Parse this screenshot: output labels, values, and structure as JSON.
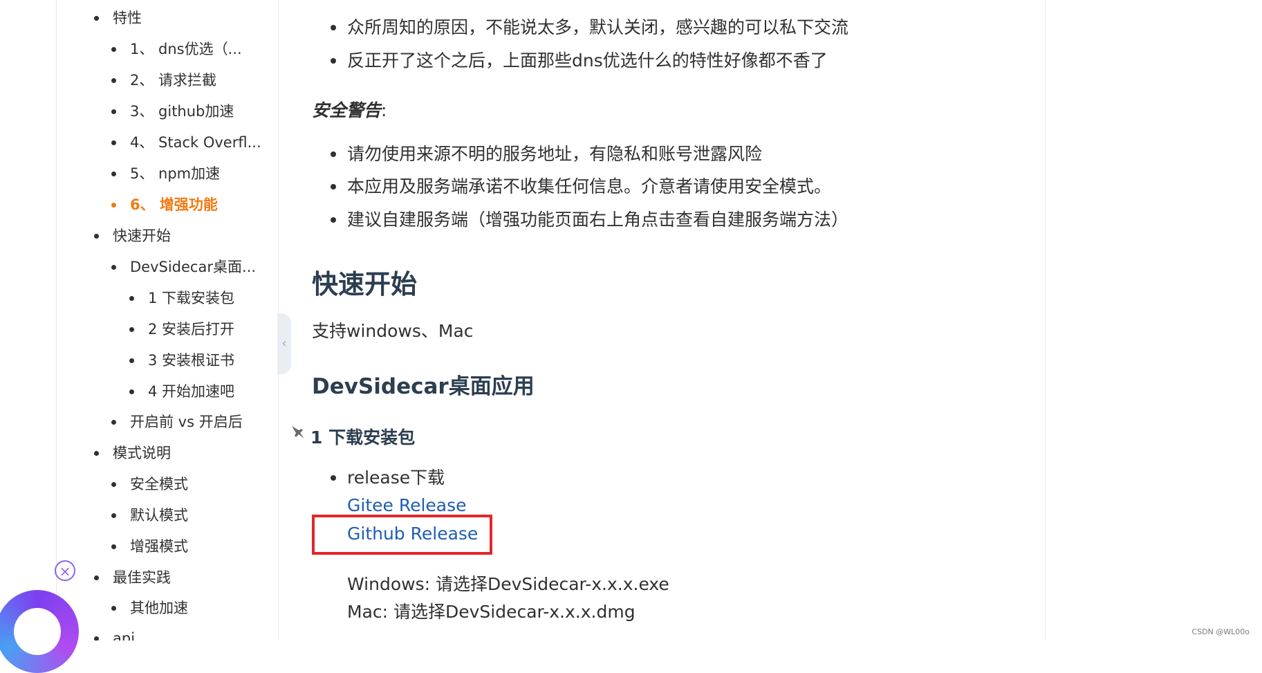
{
  "sidebar": {
    "items": [
      {
        "label": "特性"
      },
      {
        "label": "1、 dns优选（..."
      },
      {
        "label": "2、 请求拦截"
      },
      {
        "label": "3、 github加速"
      },
      {
        "label": "4、 Stack Overfl..."
      },
      {
        "label": "5、 npm加速"
      },
      {
        "label": "6、 增强功能",
        "active": true
      },
      {
        "label": "快速开始"
      },
      {
        "label": "DevSidecar桌面..."
      },
      {
        "label": "1 下载安装包"
      },
      {
        "label": "2 安装后打开"
      },
      {
        "label": "3 安装根证书"
      },
      {
        "label": "4 开始加速吧"
      },
      {
        "label": "开启前 vs 开启后"
      },
      {
        "label": "模式说明"
      },
      {
        "label": "安全模式"
      },
      {
        "label": "默认模式"
      },
      {
        "label": "增强模式"
      },
      {
        "label": "最佳实践"
      },
      {
        "label": "其他加速"
      },
      {
        "label": "api"
      }
    ],
    "collapse_glyph": "‹",
    "close_glyph": "×"
  },
  "main": {
    "top_bullets": [
      "众所周知的原因，不能说太多，默认关闭，感兴趣的可以私下交流",
      "反正开了这个之后，上面那些dns优选什么的特性好像都不香了"
    ],
    "warning_label": "安全警告",
    "warning_colon": ":",
    "warning_bullets": [
      "请勿使用来源不明的服务地址，有隐私和账号泄露风险",
      "本应用及服务端承诺不收集任何信息。介意者请使用安全模式。",
      "建议自建服务端（增强功能页面右上角点击查看自建服务端方法）"
    ],
    "heading_quickstart": "快速开始",
    "support_text": "支持windows、Mac",
    "heading_app": "DevSidecar桌面应用",
    "heading_download": "1 下载安装包",
    "release_label": "release下载",
    "gitee_link": "Gitee Release",
    "github_link": "Github Release",
    "windows_text": "Windows: 请选择DevSidecar-x.x.x.exe",
    "mac_text": "Mac: 请选择DevSidecar-x.x.x.dmg"
  },
  "colors": {
    "active": "#f27a13",
    "link": "#1e5db0",
    "highlight": "#e3262a"
  },
  "watermark": "CSDN @WL00o"
}
